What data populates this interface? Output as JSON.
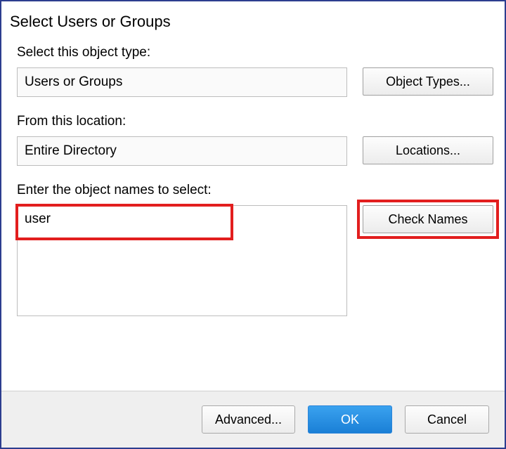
{
  "dialog": {
    "title": "Select Users or Groups",
    "object_type_label": "Select this object type:",
    "object_type_value": "Users or Groups",
    "object_types_button": "Object Types...",
    "location_label": "From this location:",
    "location_value": "Entire Directory",
    "locations_button": "Locations...",
    "names_label": "Enter the object names to select:",
    "names_value": "user",
    "check_names_button": "Check Names",
    "advanced_button": "Advanced...",
    "ok_button": "OK",
    "cancel_button": "Cancel"
  }
}
